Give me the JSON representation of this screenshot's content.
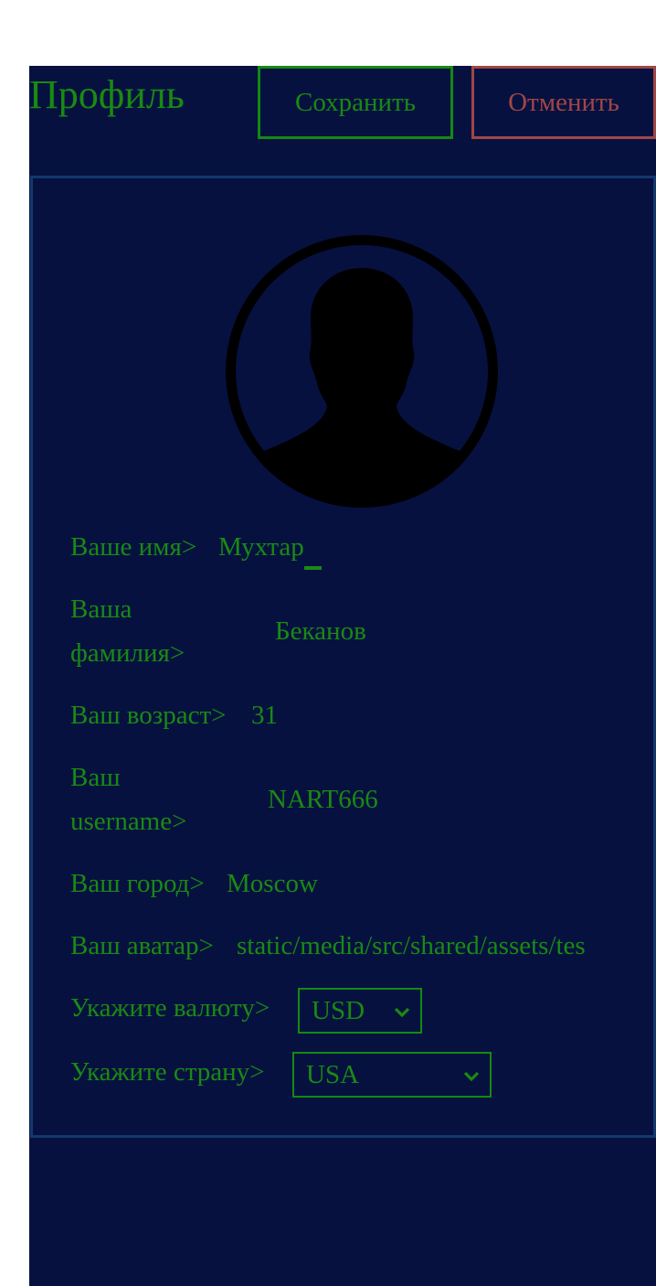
{
  "header": {
    "title": "Профиль",
    "save_label": "Сохранить",
    "cancel_label": "Отменить"
  },
  "avatar": {
    "icon": "user-silhouette-icon"
  },
  "fields": {
    "first_name": {
      "label": "Ваше имя>",
      "value": "Мухтар"
    },
    "last_name": {
      "label_line1": "Ваша",
      "label_line2": "фамилия>",
      "value": "Беканов"
    },
    "age": {
      "label": "Ваш возраст>",
      "value": "31"
    },
    "username": {
      "label_line1": "Ваш",
      "label_line2": "username>",
      "value": "NART666"
    },
    "city": {
      "label": "Ваш город>",
      "value": "Moscow"
    },
    "avatar_path": {
      "label": "Ваш аватар>",
      "value": "static/media/src/shared/assets/tes"
    },
    "currency": {
      "label": "Укажите валюту>",
      "selected": "USD"
    },
    "country": {
      "label": "Укажите страну>",
      "selected": "USA"
    }
  },
  "colors": {
    "background": "#061140",
    "accent_green": "#1a8a12",
    "cancel_red": "#a04646",
    "card_border": "#13386e"
  }
}
